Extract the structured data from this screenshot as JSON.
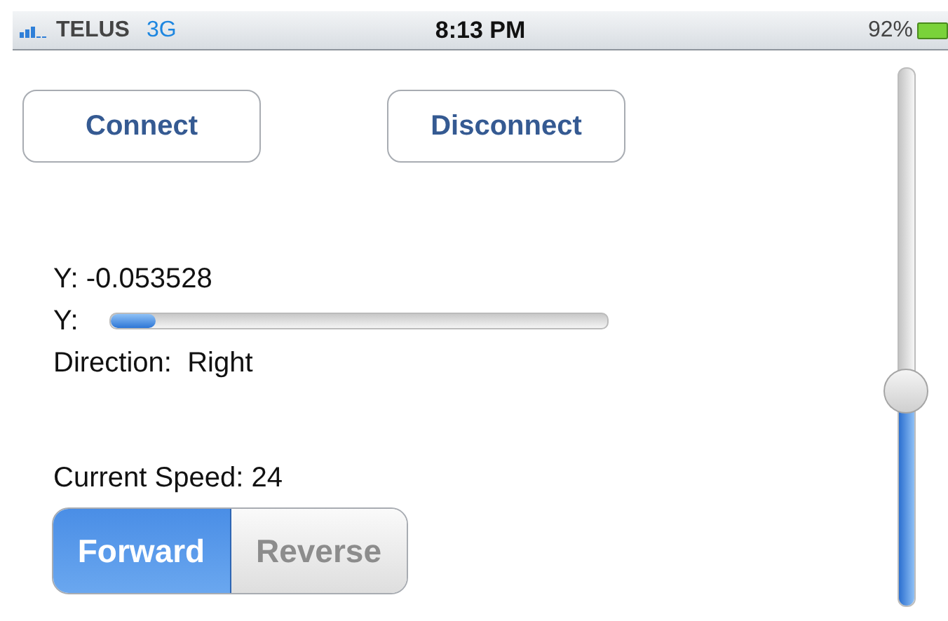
{
  "status_bar": {
    "carrier": "TELUS",
    "network": "3G",
    "time": "8:13 PM",
    "battery": "92%"
  },
  "buttons": [
    {
      "label": "Connect"
    },
    {
      "label": "Disconnect"
    }
  ],
  "y_value": "Y: -0.053528",
  "y_bar": {
    "label": "Y:",
    "level": 0.09
  },
  "direction": "Direction:  Right",
  "speed": "Current Speed: 24",
  "segments": [
    {
      "label": "Forward",
      "selected": true
    },
    {
      "label": "Reverse",
      "selected": false
    }
  ],
  "speed_slider": {
    "level": 0.4
  }
}
